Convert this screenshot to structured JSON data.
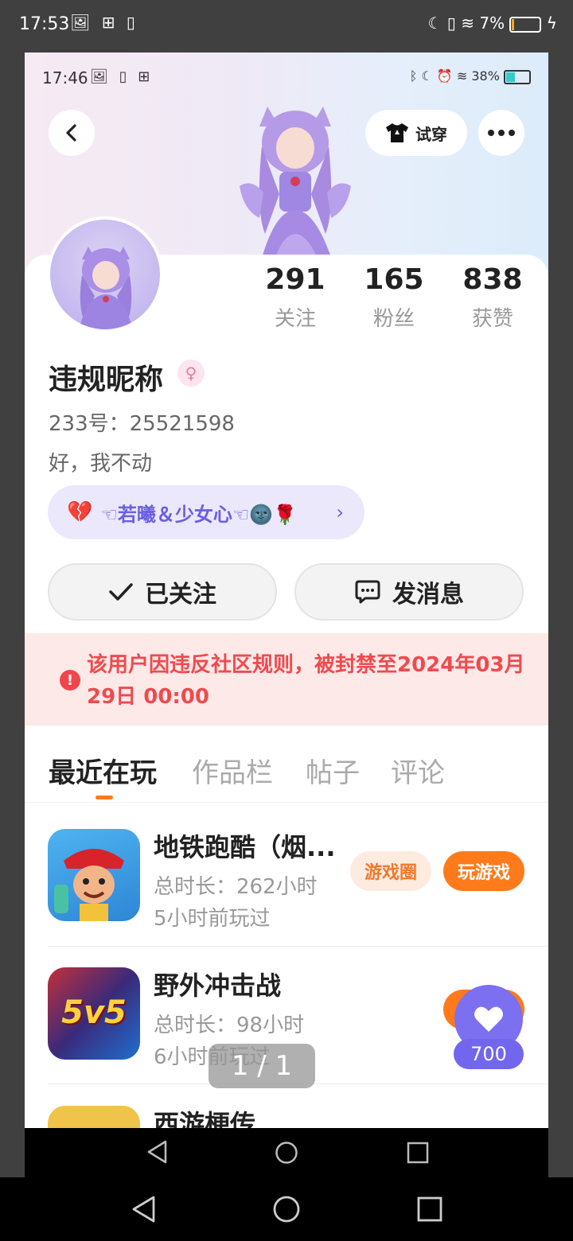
{
  "outer_status": {
    "time": "17:53",
    "icons_left": "🖼 ⊞ ▯",
    "battery": "7%"
  },
  "inner_status": {
    "time": "17:46",
    "icons_left": "🖼 ▯ ⊞",
    "battery": "38%"
  },
  "header": {
    "tryon_label": "试穿"
  },
  "stats": [
    {
      "value": "291",
      "label": "关注"
    },
    {
      "value": "165",
      "label": "粉丝"
    },
    {
      "value": "838",
      "label": "获赞"
    }
  ],
  "profile": {
    "nickname": "违规昵称",
    "uid": "233号：25521598",
    "bio": "好，我不动"
  },
  "fan_tag": {
    "text": "☜若曦＆少女心☜🌚🌹"
  },
  "actions": {
    "followed_label": "已关注",
    "message_label": "发消息"
  },
  "ban_notice": {
    "text": "该用户因违反社区规则，被封禁至2024年03月29日 00:00"
  },
  "tabs": [
    "最近在玩",
    "作品栏",
    "帖子",
    "评论"
  ],
  "games": [
    {
      "name": "地铁跑酷（烟...",
      "duration": "总时长：262小时",
      "last_played": "5小时前玩过",
      "circle_label": "游戏圈",
      "play_label": "玩游戏"
    },
    {
      "name": "野外冲击战",
      "duration": "总时长：98小时",
      "last_played": "6小时前玩过",
      "icon_text": "5v5"
    },
    {
      "name": "西游梗传"
    }
  ],
  "like_count": "700",
  "page_indicator": "1 / 1"
}
